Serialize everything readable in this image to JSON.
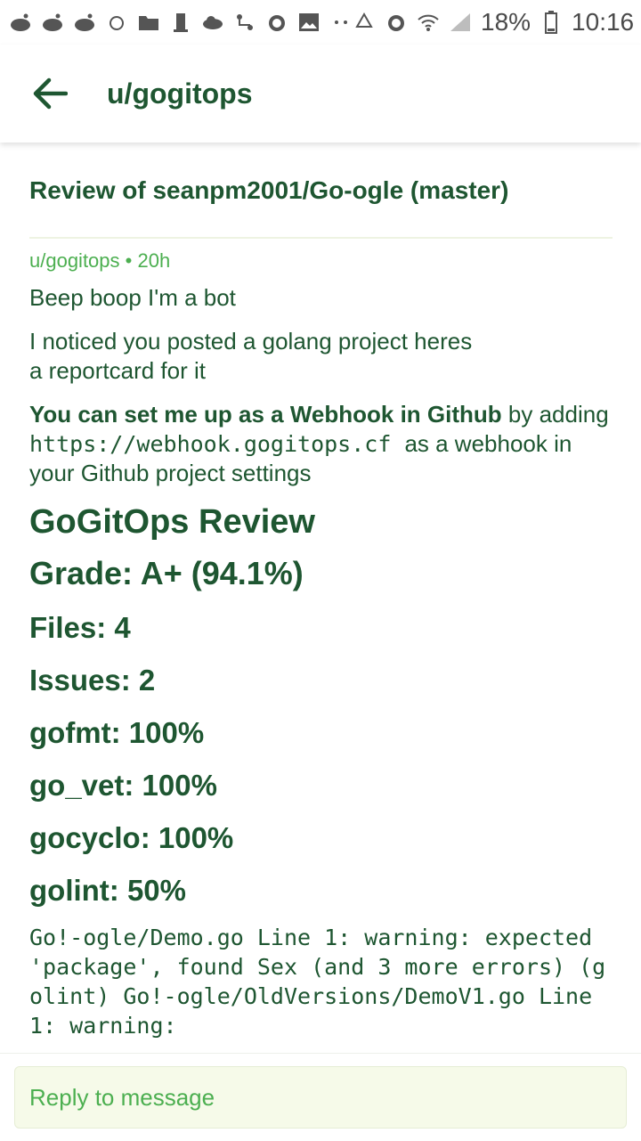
{
  "status_bar": {
    "left_icons": [
      "reddit-icon",
      "reddit-icon",
      "reddit-icon",
      "bug-icon",
      "folder-icon",
      "building-icon",
      "cloud-icon",
      "route-icon",
      "alarm-icon",
      "image-icon",
      "dots-icon"
    ],
    "right_icons": [
      "recycle-icon",
      "alarm-icon",
      "wifi-icon",
      "signal-icon"
    ],
    "battery": "18%",
    "time": "10:16"
  },
  "appbar": {
    "title": "u/gogitops",
    "back_icon": "arrow-left-icon"
  },
  "message": {
    "subject": "Review of seanpm2001/Go-ogle (master)",
    "author": "u/gogitops",
    "separator": " • ",
    "age": "20h",
    "para1": "Beep boop I'm a bot",
    "para2_line1": "I noticed you posted a golang project heres",
    "para2_line2": "a reportcard for it",
    "webhook_strong": "You can set me up as a Webhook in Github",
    "webhook_by": " by adding ",
    "webhook_url": " https://webhook.gogitops.cf ",
    "webhook_rest": "as a webhook in your Github project settings",
    "review_heading": "GoGitOps Review",
    "grade": "Grade: A+ (94.1%)",
    "files": "Files: 4",
    "issues": "Issues: 2",
    "gofmt": "gofmt: 100%",
    "go_vet": "go_vet: 100%",
    "gocyclo": "gocyclo: 100%",
    "golint": "golint: 50%",
    "warning_text": "Go!-ogle/Demo.go Line 1: warning: expected 'package', found Sex (and 3 more errors) (golint) Go!-ogle/OldVersions/DemoV1.go Line 1: warning:"
  },
  "reply": {
    "placeholder": "Reply to message"
  },
  "colors": {
    "primary_text": "#1e5631",
    "accent_green": "#4caf50",
    "reply_bg": "#f6fae9"
  }
}
